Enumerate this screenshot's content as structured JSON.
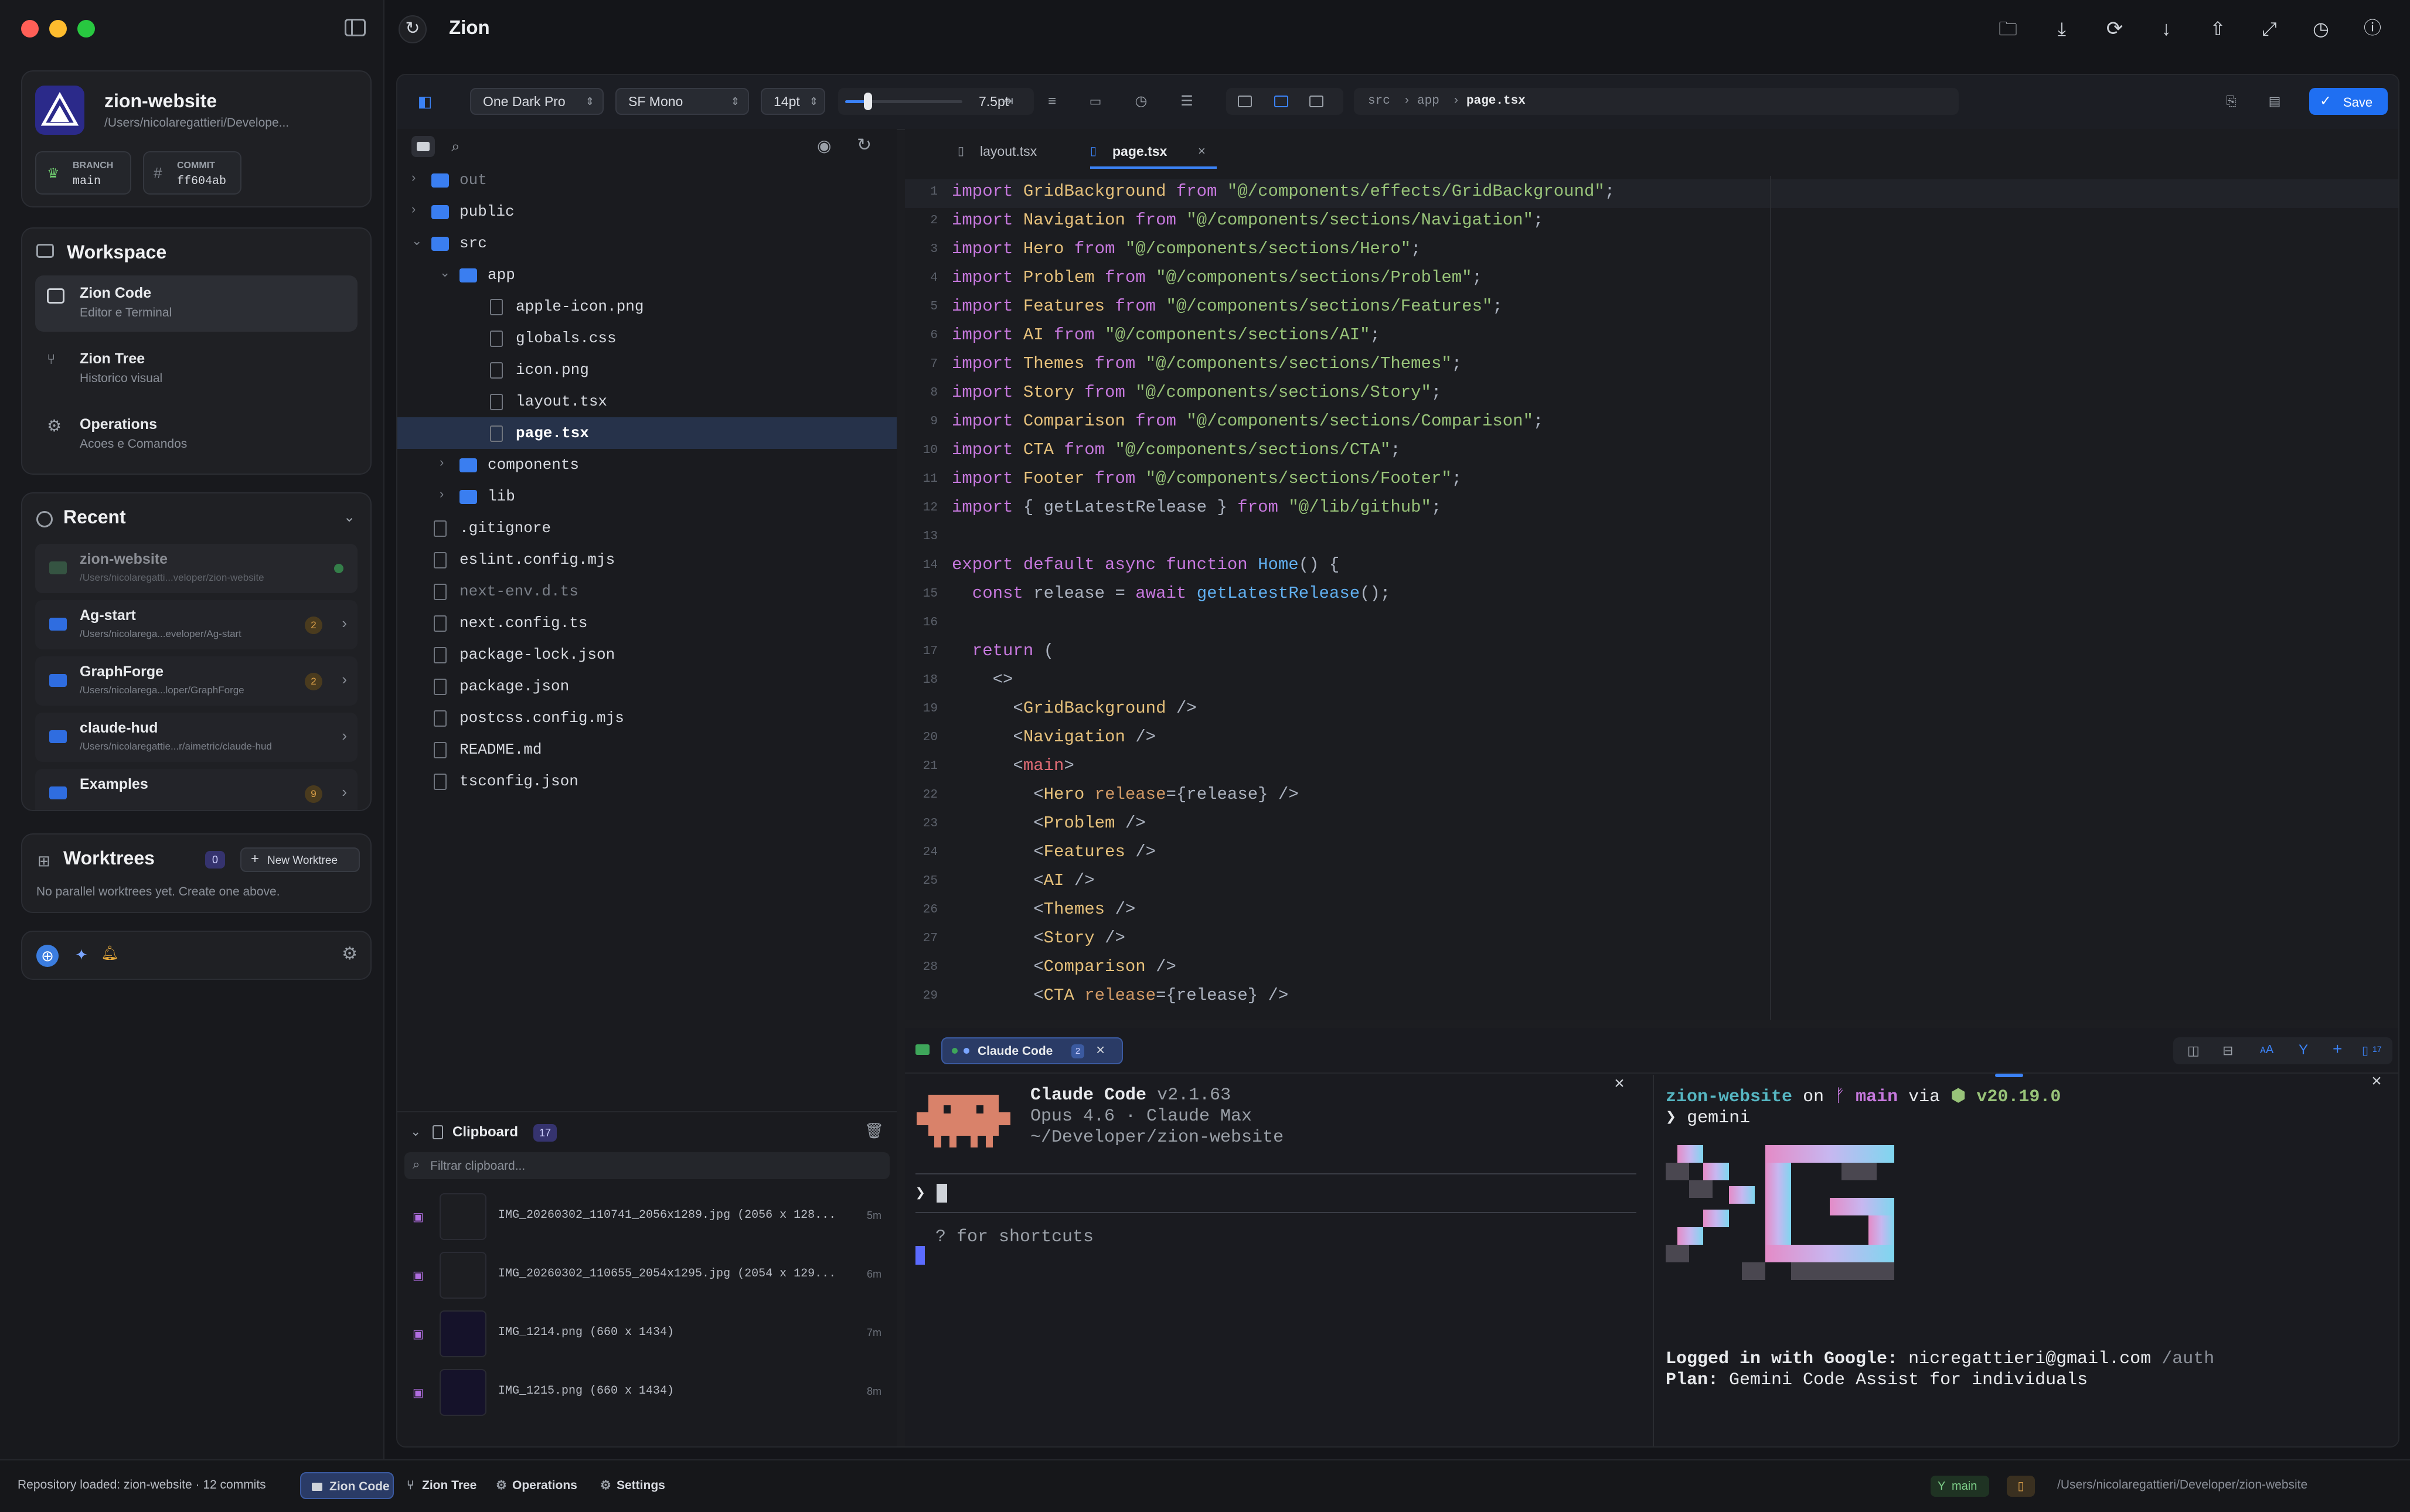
{
  "app": {
    "title": "Zion"
  },
  "project": {
    "name": "zion-website",
    "path": "/Users/nicolaregattieri/Develope...",
    "branch_label": "BRANCH",
    "branch": "main",
    "commit_label": "COMMIT",
    "commit": "ff604ab"
  },
  "workspace": {
    "title": "Workspace",
    "items": [
      {
        "title": "Zion Code",
        "sub": "Editor e Terminal"
      },
      {
        "title": "Zion Tree",
        "sub": "Historico visual"
      },
      {
        "title": "Operations",
        "sub": "Acoes e Comandos"
      }
    ]
  },
  "recent": {
    "title": "Recent",
    "items": [
      {
        "name": "zion-website",
        "path": "/Users/nicolaregatti...veloper/zion-website",
        "badge": ""
      },
      {
        "name": "Ag-start",
        "path": "/Users/nicolarega...eveloper/Ag-start",
        "badge": "2"
      },
      {
        "name": "GraphForge",
        "path": "/Users/nicolarega...loper/GraphForge",
        "badge": "2"
      },
      {
        "name": "claude-hud",
        "path": "/Users/nicolaregattie...r/aimetric/claude-hud",
        "badge": ""
      },
      {
        "name": "Examples",
        "path": "",
        "badge": "9"
      }
    ]
  },
  "worktrees": {
    "title": "Worktrees",
    "count": "0",
    "new_label": "New Worktree",
    "empty": "No parallel worktrees yet. Create one above."
  },
  "toolbar": {
    "theme": "One Dark Pro",
    "font": "SF Mono",
    "size": "14pt",
    "spacing": "7.5pt",
    "crumb": [
      "src",
      "app",
      "page.tsx"
    ],
    "save": "Save"
  },
  "tree": [
    {
      "name": "out",
      "kind": "folder",
      "depth": 0,
      "dim": true,
      "open": false
    },
    {
      "name": "public",
      "kind": "folder",
      "depth": 0,
      "open": false
    },
    {
      "name": "src",
      "kind": "folder",
      "depth": 0,
      "open": true
    },
    {
      "name": "app",
      "kind": "folder",
      "depth": 1,
      "open": true
    },
    {
      "name": "apple-icon.png",
      "kind": "file",
      "depth": 2
    },
    {
      "name": "globals.css",
      "kind": "file",
      "depth": 2
    },
    {
      "name": "icon.png",
      "kind": "file",
      "depth": 2
    },
    {
      "name": "layout.tsx",
      "kind": "file",
      "depth": 2
    },
    {
      "name": "page.tsx",
      "kind": "file",
      "depth": 2,
      "selected": true
    },
    {
      "name": "components",
      "kind": "folder",
      "depth": 1,
      "open": false
    },
    {
      "name": "lib",
      "kind": "folder",
      "depth": 1,
      "open": false
    },
    {
      "name": ".gitignore",
      "kind": "file",
      "depth": 0
    },
    {
      "name": "eslint.config.mjs",
      "kind": "file",
      "depth": 0
    },
    {
      "name": "next-env.d.ts",
      "kind": "file",
      "depth": 0,
      "dim": true
    },
    {
      "name": "next.config.ts",
      "kind": "file",
      "depth": 0
    },
    {
      "name": "package-lock.json",
      "kind": "file",
      "depth": 0
    },
    {
      "name": "package.json",
      "kind": "file",
      "depth": 0
    },
    {
      "name": "postcss.config.mjs",
      "kind": "file",
      "depth": 0
    },
    {
      "name": "README.md",
      "kind": "file",
      "depth": 0
    },
    {
      "name": "tsconfig.json",
      "kind": "file",
      "depth": 0
    }
  ],
  "tabs": [
    {
      "label": "layout.tsx"
    },
    {
      "label": "page.tsx"
    }
  ],
  "code": [
    [
      [
        "kw",
        "import "
      ],
      [
        "id",
        "GridBackground"
      ],
      [
        "kw",
        " from "
      ],
      [
        "st",
        "\"@/components/effects/GridBackground\""
      ],
      [
        "pl",
        ";"
      ]
    ],
    [
      [
        "kw",
        "import "
      ],
      [
        "id",
        "Navigation"
      ],
      [
        "kw",
        " from "
      ],
      [
        "st",
        "\"@/components/sections/Navigation\""
      ],
      [
        "pl",
        ";"
      ]
    ],
    [
      [
        "kw",
        "import "
      ],
      [
        "id",
        "Hero"
      ],
      [
        "kw",
        " from "
      ],
      [
        "st",
        "\"@/components/sections/Hero\""
      ],
      [
        "pl",
        ";"
      ]
    ],
    [
      [
        "kw",
        "import "
      ],
      [
        "id",
        "Problem"
      ],
      [
        "kw",
        " from "
      ],
      [
        "st",
        "\"@/components/sections/Problem\""
      ],
      [
        "pl",
        ";"
      ]
    ],
    [
      [
        "kw",
        "import "
      ],
      [
        "id",
        "Features"
      ],
      [
        "kw",
        " from "
      ],
      [
        "st",
        "\"@/components/sections/Features\""
      ],
      [
        "pl",
        ";"
      ]
    ],
    [
      [
        "kw",
        "import "
      ],
      [
        "id",
        "AI"
      ],
      [
        "kw",
        " from "
      ],
      [
        "st",
        "\"@/components/sections/AI\""
      ],
      [
        "pl",
        ";"
      ]
    ],
    [
      [
        "kw",
        "import "
      ],
      [
        "id",
        "Themes"
      ],
      [
        "kw",
        " from "
      ],
      [
        "st",
        "\"@/components/sections/Themes\""
      ],
      [
        "pl",
        ";"
      ]
    ],
    [
      [
        "kw",
        "import "
      ],
      [
        "id",
        "Story"
      ],
      [
        "kw",
        " from "
      ],
      [
        "st",
        "\"@/components/sections/Story\""
      ],
      [
        "pl",
        ";"
      ]
    ],
    [
      [
        "kw",
        "import "
      ],
      [
        "id",
        "Comparison"
      ],
      [
        "kw",
        " from "
      ],
      [
        "st",
        "\"@/components/sections/Comparison\""
      ],
      [
        "pl",
        ";"
      ]
    ],
    [
      [
        "kw",
        "import "
      ],
      [
        "id",
        "CTA"
      ],
      [
        "kw",
        " from "
      ],
      [
        "st",
        "\"@/components/sections/CTA\""
      ],
      [
        "pl",
        ";"
      ]
    ],
    [
      [
        "kw",
        "import "
      ],
      [
        "id",
        "Footer"
      ],
      [
        "kw",
        " from "
      ],
      [
        "st",
        "\"@/components/sections/Footer\""
      ],
      [
        "pl",
        ";"
      ]
    ],
    [
      [
        "kw",
        "import "
      ],
      [
        "pl",
        "{ getLatestRelease } "
      ],
      [
        "kw",
        "from "
      ],
      [
        "st",
        "\"@/lib/github\""
      ],
      [
        "pl",
        ";"
      ]
    ],
    [],
    [
      [
        "kw",
        "export default async function "
      ],
      [
        "fn",
        "Home"
      ],
      [
        "pl",
        "() {"
      ]
    ],
    [
      [
        "kw",
        "  const "
      ],
      [
        "pl",
        "release = "
      ],
      [
        "kw",
        "await "
      ],
      [
        "fn",
        "getLatestRelease"
      ],
      [
        "pl",
        "();"
      ]
    ],
    [],
    [
      [
        "kw",
        "  return "
      ],
      [
        "pl",
        "("
      ]
    ],
    [
      [
        "pl",
        "    <>"
      ]
    ],
    [
      [
        "pl",
        "      <"
      ],
      [
        "id",
        "GridBackground"
      ],
      [
        "pl",
        " />"
      ]
    ],
    [
      [
        "pl",
        "      <"
      ],
      [
        "id",
        "Navigation"
      ],
      [
        "pl",
        " />"
      ]
    ],
    [
      [
        "pl",
        "      <"
      ],
      [
        "tg",
        "main"
      ],
      [
        "pl",
        ">"
      ]
    ],
    [
      [
        "pl",
        "        <"
      ],
      [
        "id",
        "Hero"
      ],
      [
        "at",
        " release"
      ],
      [
        "pl",
        "={release} />"
      ]
    ],
    [
      [
        "pl",
        "        <"
      ],
      [
        "id",
        "Problem"
      ],
      [
        "pl",
        " />"
      ]
    ],
    [
      [
        "pl",
        "        <"
      ],
      [
        "id",
        "Features"
      ],
      [
        "pl",
        " />"
      ]
    ],
    [
      [
        "pl",
        "        <"
      ],
      [
        "id",
        "AI"
      ],
      [
        "pl",
        " />"
      ]
    ],
    [
      [
        "pl",
        "        <"
      ],
      [
        "id",
        "Themes"
      ],
      [
        "pl",
        " />"
      ]
    ],
    [
      [
        "pl",
        "        <"
      ],
      [
        "id",
        "Story"
      ],
      [
        "pl",
        " />"
      ]
    ],
    [
      [
        "pl",
        "        <"
      ],
      [
        "id",
        "Comparison"
      ],
      [
        "pl",
        " />"
      ]
    ],
    [
      [
        "pl",
        "        <"
      ],
      [
        "id",
        "CTA"
      ],
      [
        "at",
        " release"
      ],
      [
        "pl",
        "={release} />"
      ]
    ]
  ],
  "terminal": {
    "tab_label": "Claude Code",
    "tab_count": "2",
    "claude_title": "Claude Code",
    "claude_version": "v2.1.63",
    "claude_model": "Opus 4.6 · Claude Max",
    "claude_dir": "~/Developer/zion-website",
    "prompt": "❯",
    "hint": "? for shortcuts",
    "right_repo": "zion-website",
    "right_on": "on",
    "right_branch": "main",
    "right_via": "via",
    "right_node": "v20.19.0",
    "right_cmd": "❯ gemini",
    "logged_label": "Logged in with Google:",
    "logged_email": "nicregattieri@gmail.com",
    "logged_auth": "/auth",
    "plan_label": "Plan:",
    "plan_value": "Gemini Code Assist for individuals",
    "clip_count": "17"
  },
  "clipboard": {
    "title": "Clipboard",
    "count": "17",
    "placeholder": "Filtrar clipboard...",
    "items": [
      {
        "name": "IMG_20260302_110741_2056x1289.jpg (2056 x 128...",
        "time": "5m"
      },
      {
        "name": "IMG_20260302_110655_2054x1295.jpg (2054 x 129...",
        "time": "6m"
      },
      {
        "name": "IMG_1214.png (660 x 1434)",
        "time": "7m"
      },
      {
        "name": "IMG_1215.png (660 x 1434)",
        "time": "8m"
      }
    ]
  },
  "status": {
    "text": "Repository loaded: zion-website · 12 commits",
    "buttons": [
      "Zion Code",
      "Zion Tree",
      "Operations",
      "Settings"
    ],
    "branch": "main",
    "path": "/Users/nicolaregattieri/Developer/zion-website"
  },
  "colors": {
    "accent": "#2f6de0",
    "save": "#1f6ff2",
    "claude": "#d9826a"
  }
}
